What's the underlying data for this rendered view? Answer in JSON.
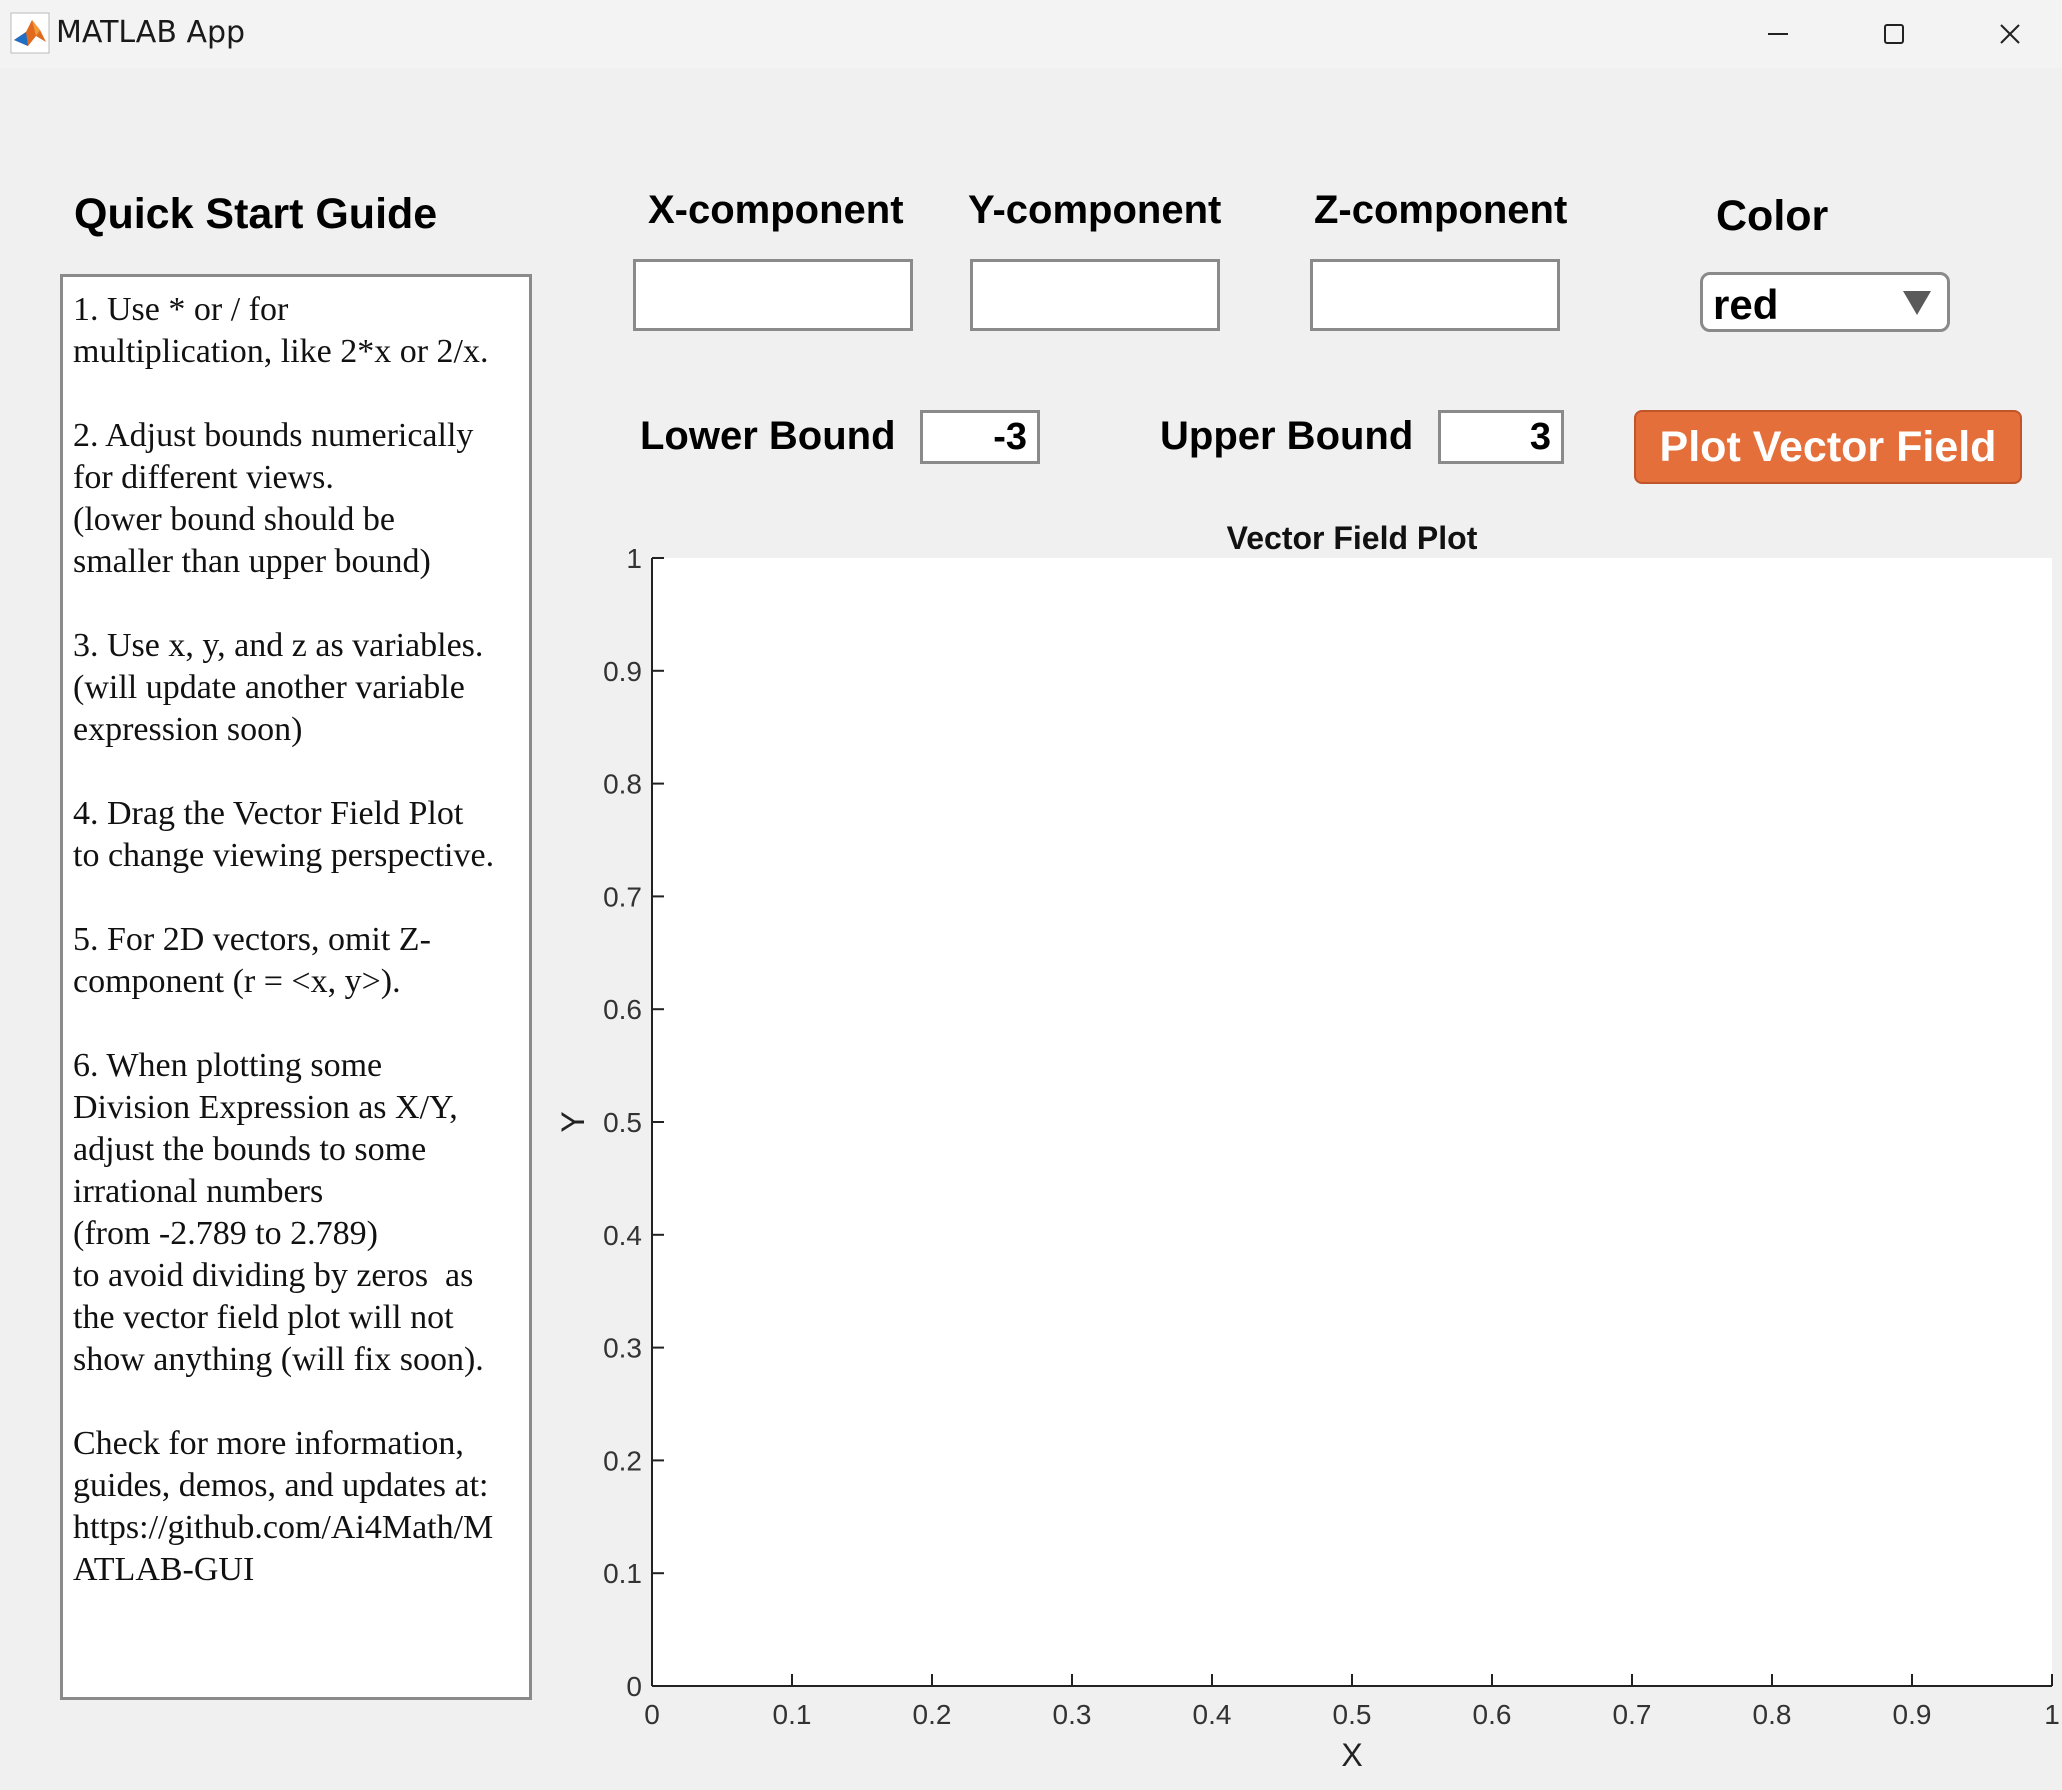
{
  "window": {
    "title": "MATLAB App",
    "icons": [
      "matlab-logo-icon",
      "minimize-icon",
      "maximize-icon",
      "close-icon"
    ]
  },
  "guide": {
    "title": "Quick Start Guide",
    "text": "1. Use * or / for\nmultiplication, like 2*x or 2/x.\n\n2. Adjust bounds numerically\nfor different views.\n(lower bound should be\nsmaller than upper bound)\n\n3. Use x, y, and z as variables.\n(will update another variable\nexpression soon)\n\n4. Drag the Vector Field Plot\nto change viewing perspective.\n\n5. For 2D vectors, omit Z-\ncomponent (r = <x, y>).\n\n6. When plotting some\nDivision Expression as X/Y,\nadjust the bounds to some\nirrational numbers\n(from -2.789 to 2.789)\nto avoid dividing by zeros  as\nthe vector field plot will not\nshow anything (will fix soon).\n\nCheck for more information,\nguides, demos, and updates at:\nhttps://github.com/Ai4Math/M\nATLAB-GUI"
  },
  "inputs": {
    "x_label": "X-component",
    "x_value": "",
    "y_label": "Y-component",
    "y_value": "",
    "z_label": "Z-component",
    "z_value": "",
    "color_label": "Color",
    "color_value": "red"
  },
  "bounds": {
    "lower_label": "Lower Bound",
    "lower_value": "-3",
    "upper_label": "Upper Bound",
    "upper_value": "3"
  },
  "plot_button": {
    "label": "Plot Vector Field",
    "color": "#e46f3b"
  },
  "chart_data": {
    "type": "scatter",
    "title": "Vector Field Plot",
    "xlabel": "X",
    "ylabel": "Y",
    "xlim": [
      0,
      1
    ],
    "ylim": [
      0,
      1
    ],
    "xticks": [
      "0",
      "0.1",
      "0.2",
      "0.3",
      "0.4",
      "0.5",
      "0.6",
      "0.7",
      "0.8",
      "0.9",
      "1"
    ],
    "yticks": [
      "0",
      "0.1",
      "0.2",
      "0.3",
      "0.4",
      "0.5",
      "0.6",
      "0.7",
      "0.8",
      "0.9",
      "1"
    ],
    "series": [],
    "grid": false
  }
}
